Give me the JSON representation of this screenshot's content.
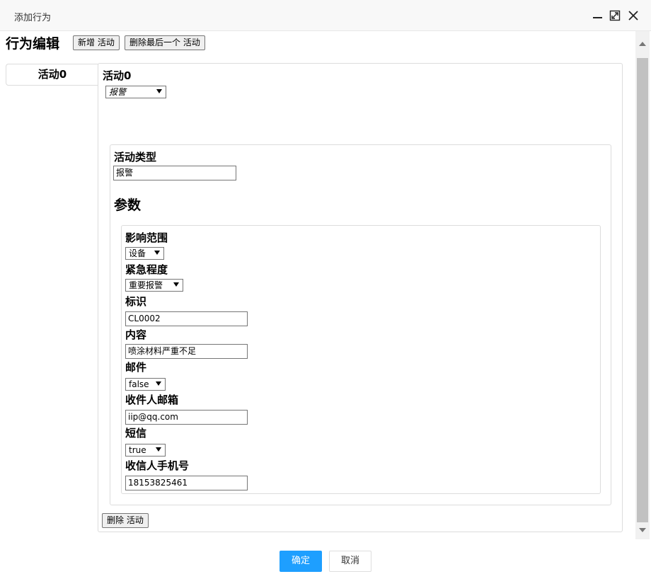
{
  "window": {
    "title": "添加行为"
  },
  "editor": {
    "heading": "行为编辑",
    "add_button": "新增 活动",
    "delete_last_button": "删除最后一个 活动",
    "tabs": [
      {
        "label": "活动0"
      }
    ]
  },
  "activity": {
    "name": "活动0",
    "type_select": "报警",
    "type_label": "活动类型",
    "type_value": "报警",
    "params_heading": "参数",
    "delete_button": "删除 活动"
  },
  "params": {
    "scope_label": "影响范围",
    "scope_value": "设备",
    "urgency_label": "紧急程度",
    "urgency_value": "重要报警",
    "id_label": "标识",
    "id_value": "CL0002",
    "content_label": "内容",
    "content_value": "喷涂材料严重不足",
    "mail_label": "邮件",
    "mail_value": "false",
    "recipient_email_label": "收件人邮箱",
    "recipient_email_value": "iip@qq.com",
    "sms_label": "短信",
    "sms_value": "true",
    "recipient_phone_label": "收信人手机号",
    "recipient_phone_value": "18153825461"
  },
  "footer": {
    "ok": "确定",
    "cancel": "取消"
  }
}
